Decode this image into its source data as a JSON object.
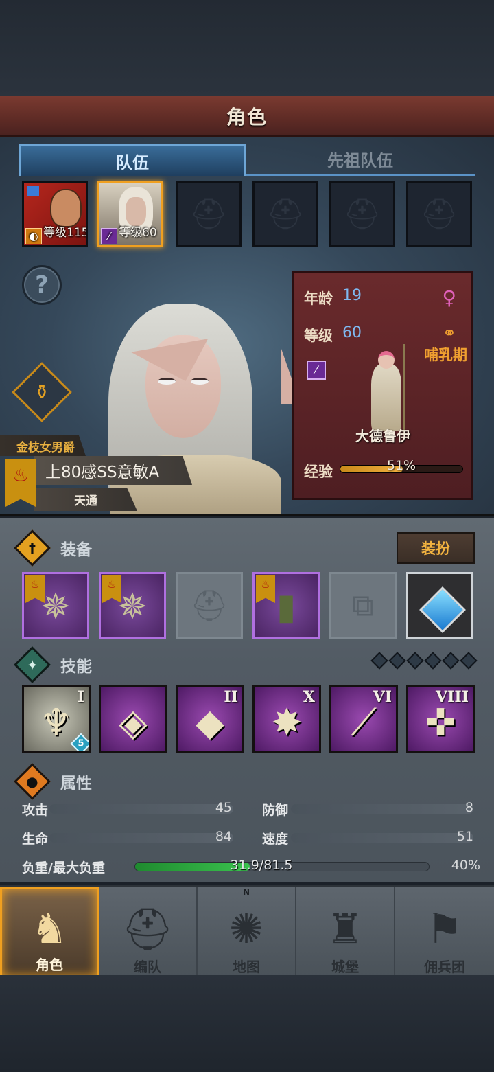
{
  "header": {
    "title": "角色"
  },
  "tabs": [
    {
      "label": "队伍",
      "active": true
    },
    {
      "label": "先祖队伍",
      "active": false
    }
  ],
  "party": [
    {
      "level_text": "等级115",
      "class_icon": "shield-icon",
      "filled": true
    },
    {
      "level_text": "等级60",
      "class_icon": "staff-icon",
      "filled": true,
      "selected": true
    },
    {
      "filled": false
    },
    {
      "filled": false
    },
    {
      "filled": false
    },
    {
      "filled": false
    }
  ],
  "character": {
    "title": "金枝女男爵",
    "name": "上80感SS意敏A",
    "trait": "天通",
    "age_label": "年龄",
    "age": "19",
    "level_label": "等级",
    "level": "60",
    "gender_icon": "female-icon",
    "life_stage": "哺乳期",
    "class_name": "大德鲁伊",
    "exp_label": "经验",
    "exp_pct": "51%",
    "exp_fraction": 0.51
  },
  "equipment": {
    "title": "装备",
    "dress_label": "装扮",
    "slots": [
      {
        "item": "mace-icon",
        "rarity": "purple"
      },
      {
        "item": "mace-icon",
        "rarity": "purple"
      },
      {
        "item": "empty-helmet-icon",
        "rarity": "empty"
      },
      {
        "item": "fur-coat-icon",
        "rarity": "purple"
      },
      {
        "item": "empty-boots-icon",
        "rarity": "empty"
      },
      {
        "item": "heart-amulet-icon",
        "rarity": "amulet"
      }
    ]
  },
  "skills": {
    "title": "技能",
    "slots": [
      {
        "rank": "I",
        "icon": "summon-totem-icon",
        "badge": "5"
      },
      {
        "rank": "",
        "icon": "crystal-tornado-icon"
      },
      {
        "rank": "II",
        "icon": "crystal-arm-icon"
      },
      {
        "rank": "X",
        "icon": "burst-icon"
      },
      {
        "rank": "VI",
        "icon": "staff-strike-icon"
      },
      {
        "rank": "VIII",
        "icon": "holy-cross-icon"
      }
    ]
  },
  "attributes": {
    "title": "属性",
    "attack_label": "攻击",
    "attack": "45",
    "defense_label": "防御",
    "defense": "8",
    "hp_label": "生命",
    "hp": "84",
    "speed_label": "速度",
    "speed": "51",
    "load_label": "负重/最大负重",
    "load_value": "31.9/81.5",
    "load_pct": "40%",
    "load_fraction": 0.39
  },
  "nav": [
    {
      "label": "角色",
      "icon": "knight-icon",
      "active": true
    },
    {
      "label": "编队",
      "icon": "warrior-helm-icon"
    },
    {
      "label": "地图",
      "icon": "compass-map-icon"
    },
    {
      "label": "城堡",
      "icon": "castle-icon"
    },
    {
      "label": "佣兵团",
      "icon": "mercenary-banner-icon"
    }
  ],
  "compass_letter": "N"
}
